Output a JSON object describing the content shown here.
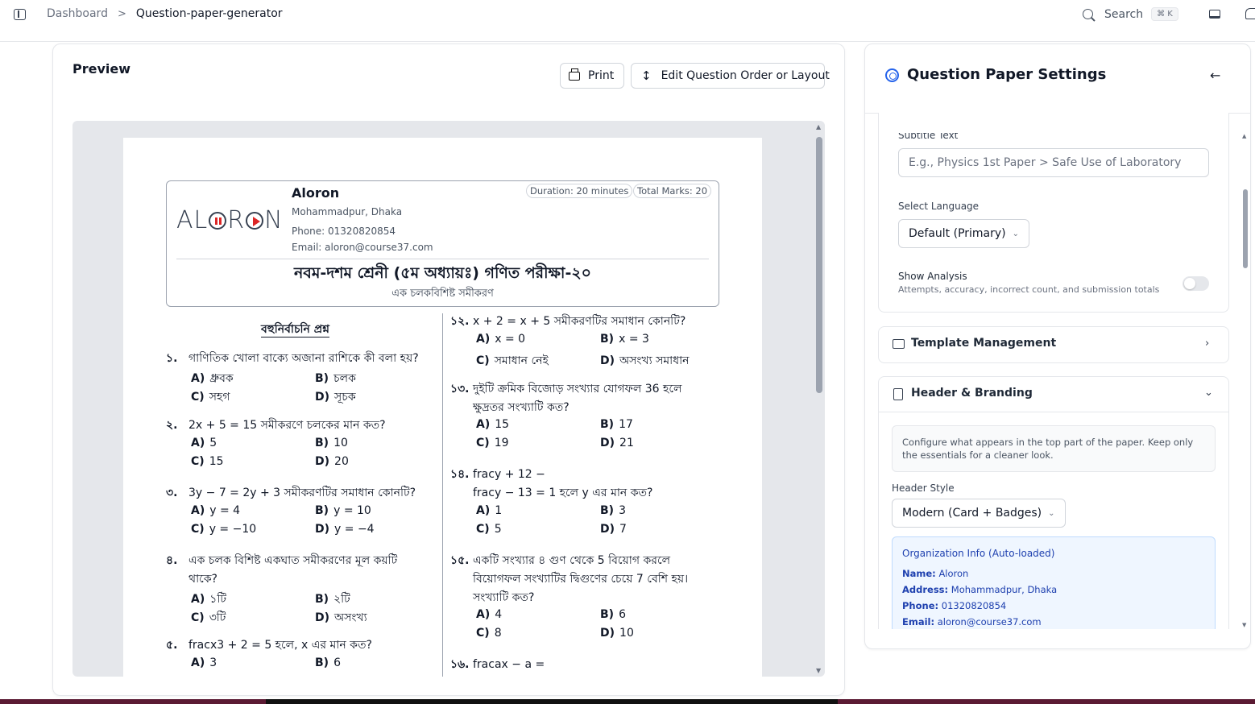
{
  "topbar": {
    "breadcrumb": [
      "Dashboard",
      "Question-paper-generator"
    ],
    "search_label": "Search",
    "search_shortcut": "⌘ K"
  },
  "preview": {
    "title": "Preview",
    "print_label": "Print",
    "edit_label": "Edit Question Order or Layout"
  },
  "paper": {
    "logo_text": "ALORON",
    "org_name": "Aloron",
    "org_address": "Mohammadpur, Dhaka",
    "org_phone": "Phone: 01320820854",
    "org_email": "Email: aloron@course37.com",
    "duration": "Duration: 20 minutes",
    "total_marks": "Total Marks: 20",
    "exam_title": "নবম-দশম শ্রেনী (৫ম অধ্যায়ঃ) গণিত পরীক্ষা-২০",
    "exam_subtitle": "এক চলকবিশিষ্ট সমীকরণ",
    "section_title": "বহুনির্বাচনি প্রশ্ন",
    "left_questions": [
      {
        "num": "১.",
        "text": "গাণিতিক খোলা বাক্যে অজানা রাশিকে কী বলা হয়?",
        "options": [
          [
            "A)",
            "ধ্রুবক"
          ],
          [
            "B)",
            "চলক"
          ],
          [
            "C)",
            "সহগ"
          ],
          [
            "D)",
            "সূচক"
          ]
        ]
      },
      {
        "num": "২.",
        "text": "2x + 5 = 15 সমীকরণে চলকের মান কত?",
        "options": [
          [
            "A)",
            "5"
          ],
          [
            "B)",
            "10"
          ],
          [
            "C)",
            "15"
          ],
          [
            "D)",
            "20"
          ]
        ]
      },
      {
        "num": "৩.",
        "text": "3y − 7 = 2y + 3 সমীকরণটির সমাধান কোনটি?",
        "options": [
          [
            "A)",
            "y = 4"
          ],
          [
            "B)",
            "y = 10"
          ],
          [
            "C)",
            "y = −10"
          ],
          [
            "D)",
            "y = −4"
          ]
        ]
      },
      {
        "num": "৪.",
        "text": "এক চলক বিশিষ্ট একঘাত সমীকরণের মূল কয়টি",
        "text2": "থাকে?",
        "options": [
          [
            "A)",
            "১টি"
          ],
          [
            "B)",
            "২টি"
          ],
          [
            "C)",
            "৩টি"
          ],
          [
            "D)",
            "অসংখ্য"
          ]
        ]
      },
      {
        "num": "৫.",
        "text": "fracx3 + 2 = 5 হলে, x এর মান কত?",
        "options": [
          [
            "A)",
            "3"
          ],
          [
            "B)",
            "6"
          ]
        ]
      }
    ],
    "right_questions": [
      {
        "num": "১২.",
        "text": "x + 2 = x + 5 সমীকরণটির সমাধান কোনটি?",
        "options": [
          [
            "A)",
            "x = 0"
          ],
          [
            "B)",
            "x = 3"
          ],
          [
            "C)",
            "সমাধান নেই"
          ],
          [
            "D)",
            "অসংখ্য সমাধান"
          ]
        ]
      },
      {
        "num": "১৩.",
        "text": "দুইটি ক্রমিক বিজোড় সংখ্যার যোগফল 36 হলে",
        "text2": "ক্ষুদ্রতর সংখ্যাটি কত?",
        "options": [
          [
            "A)",
            "15"
          ],
          [
            "B)",
            "17"
          ],
          [
            "C)",
            "19"
          ],
          [
            "D)",
            "21"
          ]
        ]
      },
      {
        "num": "১৪.",
        "text": "fracy + 12 −",
        "text2": "fracy − 13 = 1 হলে y এর মান কত?",
        "options": [
          [
            "A)",
            "1"
          ],
          [
            "B)",
            "3"
          ],
          [
            "C)",
            "5"
          ],
          [
            "D)",
            "7"
          ]
        ]
      },
      {
        "num": "১৫.",
        "text": "একটি সংখ্যার ৪ গুণ থেকে 5 বিয়োগ করলে",
        "text2": "বিয়োগফল সংখ্যাটির দ্বিগুণের চেয়ে 7 বেশি হয়।",
        "text3": "সংখ্যাটি কত?",
        "options": [
          [
            "A)",
            "4"
          ],
          [
            "B)",
            "6"
          ],
          [
            "C)",
            "8"
          ],
          [
            "D)",
            "10"
          ]
        ]
      },
      {
        "num": "১৬.",
        "text": "fracax − a =",
        "options": []
      }
    ]
  },
  "settings": {
    "title": "Question Paper Settings",
    "subtitle_label": "Subtitle Text",
    "subtitle_placeholder": "E.g., Physics 1st Paper > Safe Use of Laboratory",
    "language_label": "Select Language",
    "language_value": "Default (Primary)",
    "analysis_label": "Show Analysis",
    "analysis_desc": "Attempts, accuracy, incorrect count, and submission totals",
    "template_title": "Template Management",
    "header_title": "Header & Branding",
    "header_info": "Configure what appears in the top part of the paper. Keep only the essentials for a cleaner look.",
    "header_style_label": "Header Style",
    "header_style_value": "Modern (Card + Badges)",
    "org_info_title": "Organization Info (Auto-loaded)",
    "org_info": {
      "name_k": "Name:",
      "name_v": "Aloron",
      "address_k": "Address:",
      "address_v": "Mohammadpur, Dhaka",
      "phone_k": "Phone:",
      "phone_v": "01320820854",
      "email_k": "Email:",
      "email_v": "aloron@course37.com"
    }
  },
  "colors": {
    "accent": "#2563eb",
    "info_bg": "#eff6ff",
    "info_text": "#1e40af"
  }
}
